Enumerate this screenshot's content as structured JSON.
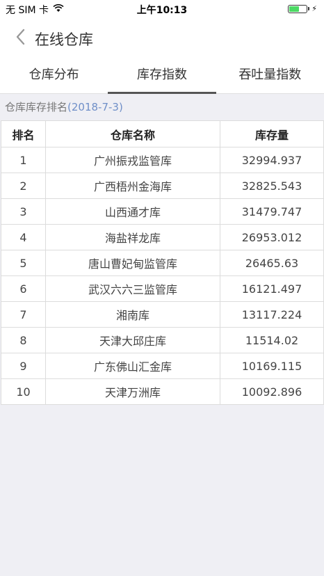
{
  "status_bar": {
    "carrier": "无 SIM 卡",
    "time": "上午10:13",
    "icons": [
      "wifi-icon",
      "battery-icon",
      "charging-bolt-icon"
    ]
  },
  "nav": {
    "title": "在线仓库",
    "back_icon": "chevron-left-icon"
  },
  "tabs": [
    {
      "label": "仓库分布",
      "active": false
    },
    {
      "label": "库存指数",
      "active": true
    },
    {
      "label": "吞吐量指数",
      "active": false
    }
  ],
  "section": {
    "title": "仓库库存排名",
    "date": "(2018-7-3)"
  },
  "table": {
    "headers": [
      "排名",
      "仓库名称",
      "库存量"
    ],
    "rows": [
      [
        "1",
        "广州振戎监管库",
        "32994.937"
      ],
      [
        "2",
        "广西梧州金海库",
        "32825.543"
      ],
      [
        "3",
        "山西通才库",
        "31479.747"
      ],
      [
        "4",
        "海盐祥龙库",
        "26953.012"
      ],
      [
        "5",
        "唐山曹妃甸监管库",
        "26465.63"
      ],
      [
        "6",
        "武汉六六三监管库",
        "16121.497"
      ],
      [
        "7",
        "湘南库",
        "13117.224"
      ],
      [
        "8",
        "天津大邱庄库",
        "11514.02"
      ],
      [
        "9",
        "广东佛山汇金库",
        "10169.115"
      ],
      [
        "10",
        "天津万洲库",
        "10092.896"
      ]
    ]
  },
  "colors": {
    "accent_date": "#6f8fc8",
    "tab_indicator": "#555555",
    "battery_fill": "#4cd964"
  }
}
